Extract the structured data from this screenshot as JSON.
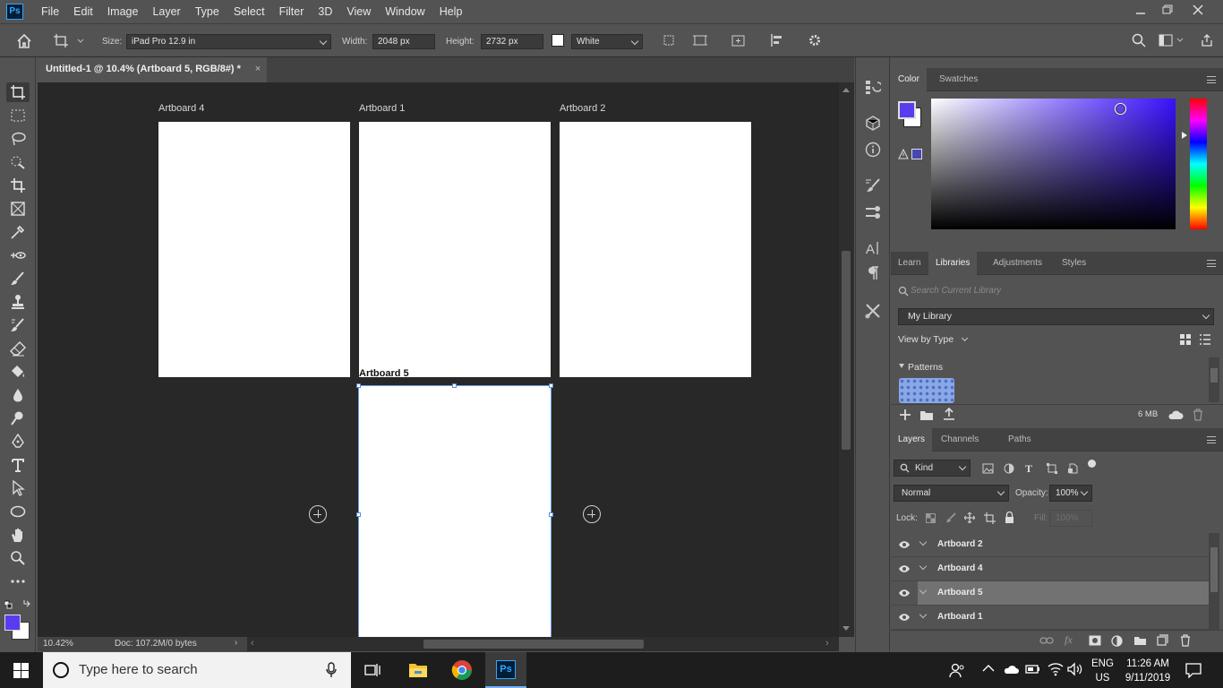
{
  "app": {
    "logo": "Ps",
    "menus": [
      "File",
      "Edit",
      "Image",
      "Layer",
      "Type",
      "Select",
      "Filter",
      "3D",
      "View",
      "Window",
      "Help"
    ]
  },
  "options": {
    "size_label": "Size:",
    "size_value": "iPad Pro 12.9 in",
    "width_label": "Width:",
    "width_value": "2048 px",
    "height_label": "Height:",
    "height_value": "2732 px",
    "bg_value": "White"
  },
  "document": {
    "tab_title": "Untitled-1 @ 10.4% (Artboard 5, RGB/8#) *",
    "close": "×"
  },
  "canvas": {
    "artboards": [
      "Artboard 4",
      "Artboard 1",
      "Artboard 2",
      "Artboard 5"
    ]
  },
  "status": {
    "zoom": "10.42%",
    "doc": "Doc: 107.2M/0 bytes"
  },
  "color_panel": {
    "tabs": [
      "Color",
      "Swatches"
    ],
    "fg_color": "#5a3cf0",
    "bg_color": "#ffffff"
  },
  "libraries_panel": {
    "tabs": [
      "Learn",
      "Libraries",
      "Adjustments",
      "Styles"
    ],
    "search_placeholder": "Search Current Library",
    "library": "My Library",
    "view_by": "View by Type",
    "section": "Patterns",
    "size": "6 MB"
  },
  "layers_panel": {
    "tabs": [
      "Layers",
      "Channels",
      "Paths"
    ],
    "kind": "Kind",
    "blend": "Normal",
    "opacity_label": "Opacity:",
    "opacity": "100%",
    "lock_label": "Lock:",
    "fill_label": "Fill:",
    "fill": "100%",
    "layers": [
      "Artboard 2",
      "Artboard 4",
      "Artboard 5",
      "Artboard 1"
    ]
  },
  "taskbar": {
    "search_placeholder": "Type here to search",
    "lang1": "ENG",
    "lang2": "US",
    "time": "11:26 AM",
    "date": "9/11/2019"
  }
}
